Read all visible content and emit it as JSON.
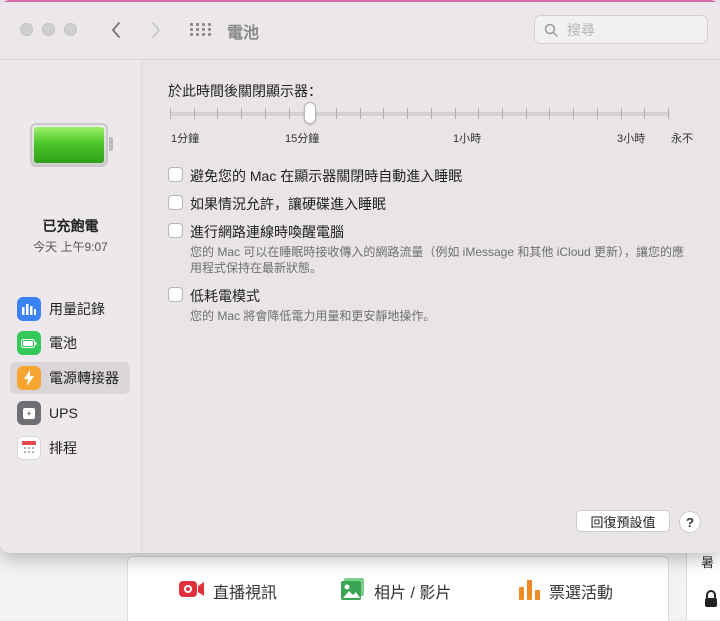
{
  "window": {
    "title": "電池",
    "search_placeholder": "搜尋"
  },
  "sidebar": {
    "status_title": "已充飽電",
    "status_time": "今天 上午9:07",
    "battery_level": 1.0,
    "items": [
      {
        "label": "用量記錄",
        "icon": "chart-bars-icon",
        "color": "#3b82f6"
      },
      {
        "label": "電池",
        "icon": "battery-icon",
        "color": "#34c759"
      },
      {
        "label": "電源轉接器",
        "icon": "lightning-icon",
        "color": "#f7a531"
      },
      {
        "label": "UPS",
        "icon": "ups-icon",
        "color": "#6e6e73"
      },
      {
        "label": "排程",
        "icon": "calendar-icon",
        "color": "#ffffff"
      }
    ],
    "selected_index": 2
  },
  "main": {
    "slider_title": "於此時間後關閉顯示器：",
    "slider_labels": [
      "1分鐘",
      "15分鐘",
      "1小時",
      "3小時",
      "永不"
    ],
    "slider_value": "15分鐘",
    "options": [
      {
        "label": "避免您的 Mac 在顯示器關閉時自動進入睡眠",
        "checked": false,
        "desc": ""
      },
      {
        "label": "如果情況允許，讓硬碟進入睡眠",
        "checked": false,
        "desc": ""
      },
      {
        "label": "進行網路連線時喚醒電腦",
        "checked": false,
        "desc_line1": "您的 Mac 可以在睡眠時接收傳入的網路流量（例如 iMessage 和其他 iCloud 更新），讓您的應",
        "desc_line2": "用程式保持在最新狀態。"
      },
      {
        "label": "低耗電模式",
        "checked": false,
        "desc_line1": "您的 Mac 將會降低電力用量和更安靜地操作。"
      }
    ],
    "reset_label": "回復預設值",
    "help_label": "?"
  },
  "background": {
    "links": [
      "直播視訊",
      "相片 / 影片",
      "票選活動"
    ],
    "colors": {
      "live": "#e0323c",
      "photos": "#3aa655",
      "polls": "#f08a24"
    }
  }
}
